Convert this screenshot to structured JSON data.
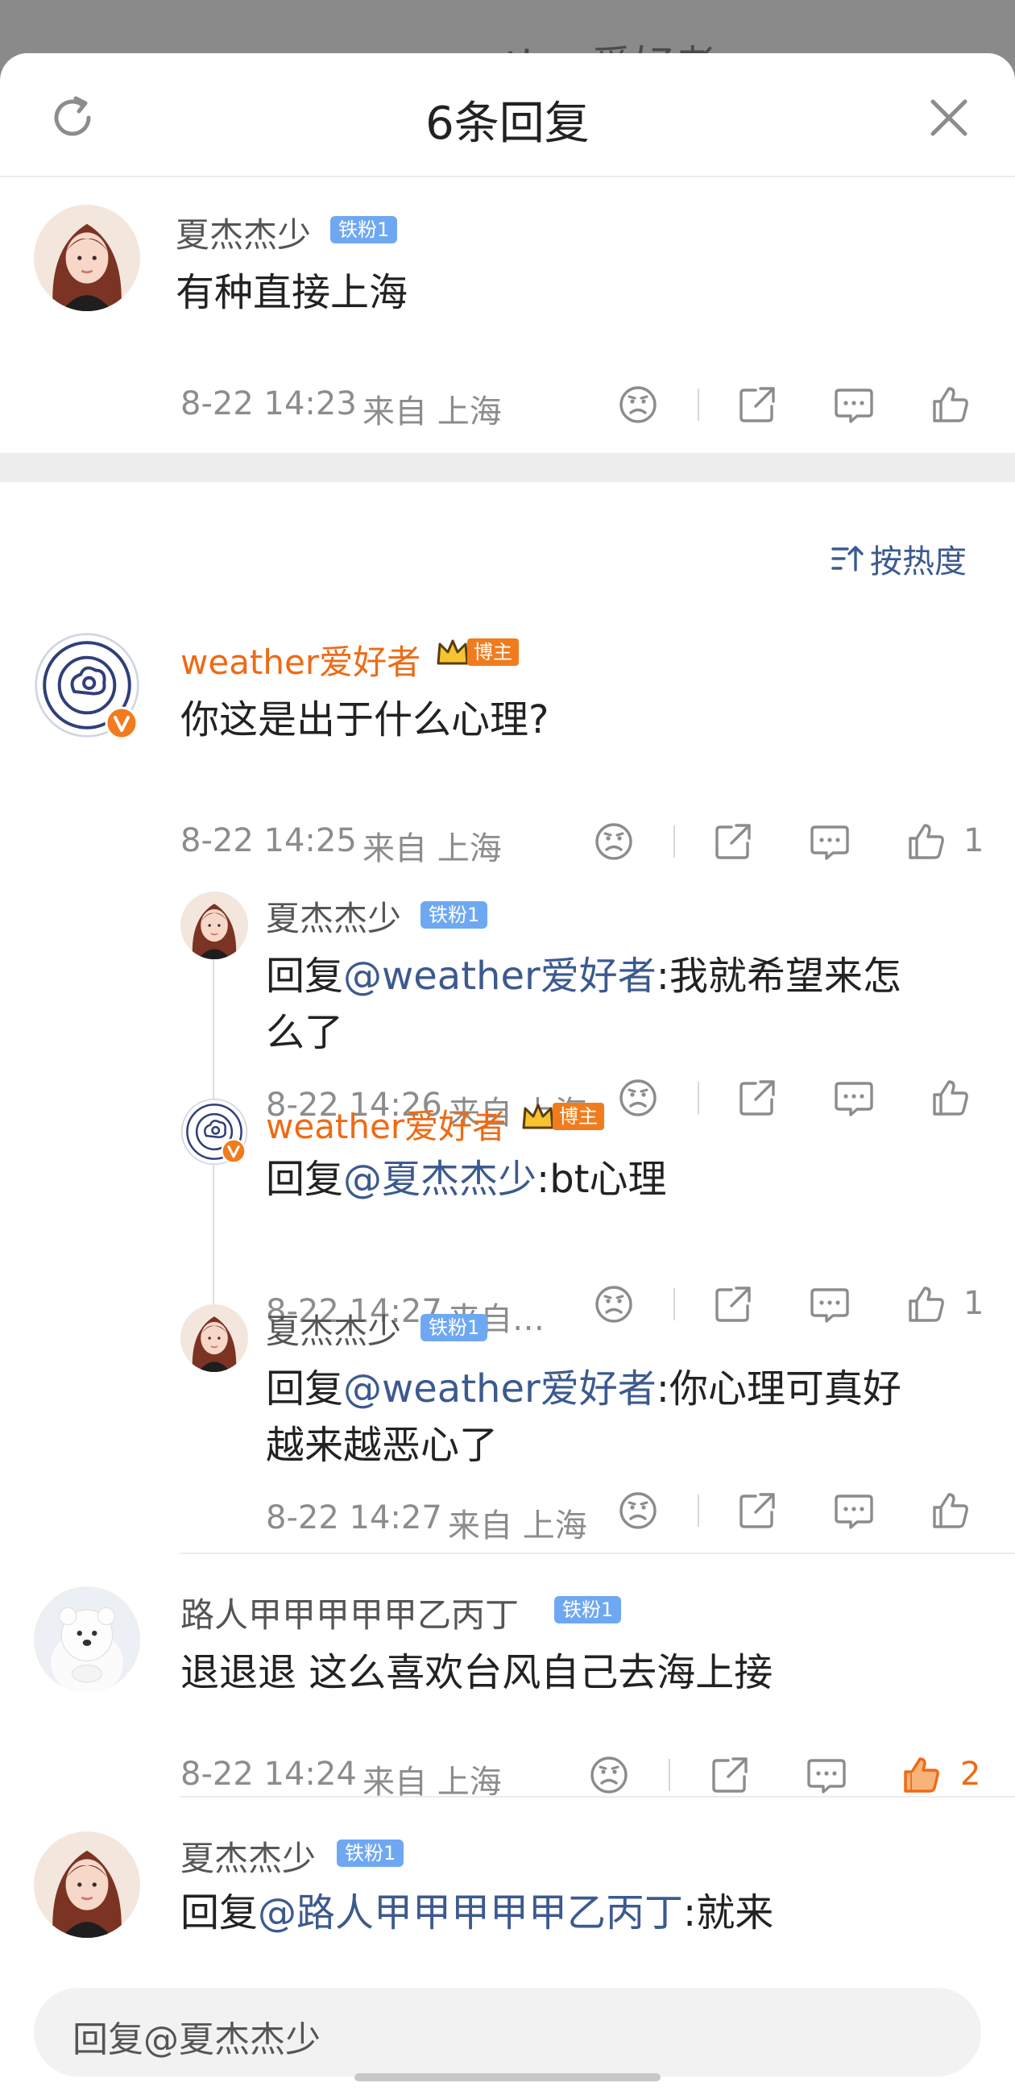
{
  "backdrop": {
    "title": "weather爱好者"
  },
  "header": {
    "title": "6条回复"
  },
  "root_comment": {
    "user": "夏杰杰少",
    "badge": "铁粉1",
    "text": "有种直接上海",
    "time": "8-22 14:23",
    "location": "来自 上海"
  },
  "sort": {
    "label": "按热度"
  },
  "replies": [
    {
      "user": "weather爱好者",
      "badge": "博主",
      "text": "你这是出于什么心理?",
      "time": "8-22 14:25",
      "location": "来自 上海",
      "likes": "1",
      "sub": [
        {
          "user": "夏杰杰少",
          "badge": "铁粉1",
          "prefix": "回复",
          "mention": "@weather爱好者",
          "text": ":我就希望来怎",
          "text2": "么了",
          "time": "8-22 14:26",
          "location": "来自 上海"
        },
        {
          "user": "weather爱好者",
          "badge": "博主",
          "prefix": "回复",
          "mention": "@夏杰杰少",
          "text": ":bt心理",
          "time": "8-22 14:27",
          "location": "来自…",
          "likes": "1"
        },
        {
          "user": "夏杰杰少",
          "badge": "铁粉1",
          "prefix": "回复",
          "mention": "@weather爱好者",
          "text": ":你心理可真好",
          "text2": "越来越恶心了",
          "time": "8-22 14:27",
          "location": "来自 上海"
        }
      ]
    },
    {
      "user": "路人甲甲甲甲甲乙丙丁",
      "badge": "铁粉1",
      "text": "退退退 这么喜欢台风自己去海上接",
      "time": "8-22 14:24",
      "location": "来自 上海",
      "likes": "2"
    },
    {
      "user": "夏杰杰少",
      "badge": "铁粉1",
      "prefix": "回复",
      "mention": "@路人甲甲甲甲甲乙丙丁",
      "text": ":就来"
    }
  ],
  "reply_input": {
    "placeholder": "回复@夏杰杰少"
  },
  "colors": {
    "accent_orange": "#ee6a14",
    "link_blue": "#3c5a8f",
    "fan_badge": "#6fa8f2"
  }
}
